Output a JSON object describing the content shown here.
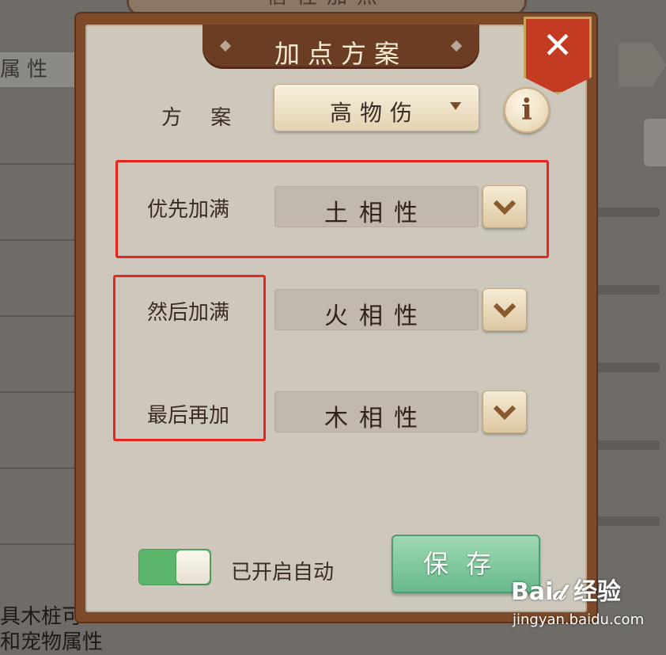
{
  "background": {
    "top_tab_label": "信性加点",
    "side_tab_label": "属性",
    "bottom_text_1": "具木桩可",
    "bottom_text_2": "和宠物属性"
  },
  "dialog": {
    "title": "加点方案",
    "close_symbol": "✕",
    "plan_label": "方 案",
    "plan_value": "高物伤",
    "info_symbol": "i",
    "rows": [
      {
        "label": "优先加满",
        "value": "土相性"
      },
      {
        "label": "然后加满",
        "value": "火相性"
      },
      {
        "label": "最后再加",
        "value": "木相性"
      }
    ],
    "auto_toggle": {
      "label": "已开启自动",
      "on": true
    },
    "save_label": "保存"
  },
  "watermark": {
    "brand": "Bai𝒹 经验",
    "url": "jingyan.baidu.com"
  },
  "colors": {
    "frame": "#7d4b2a",
    "panel": "#cdc7bc",
    "highlight_box": "#e5261f",
    "toggle_on": "#5bb56b",
    "save_button": "#69b98c",
    "close_button": "#c43b23"
  }
}
